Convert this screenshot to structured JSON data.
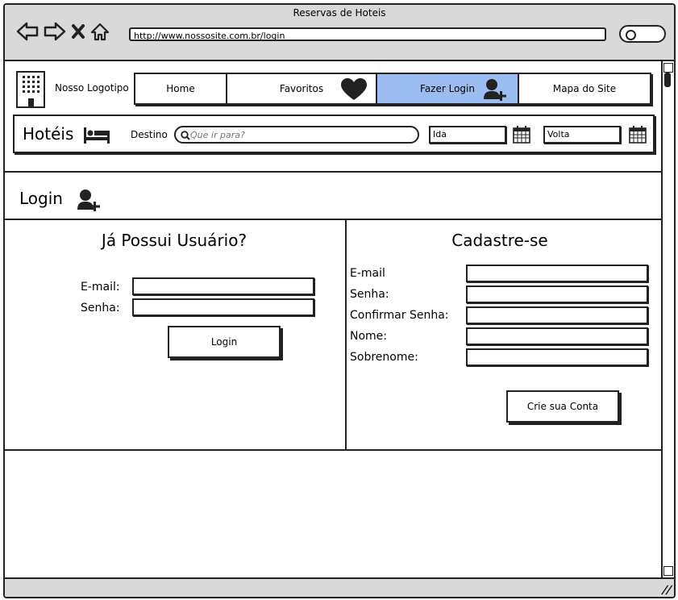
{
  "window": {
    "title": "Reservas de Hoteis"
  },
  "browser": {
    "url": "http://www.nossosite.com.br/login"
  },
  "header": {
    "logo_text": "Nosso Logotipo",
    "menu": [
      {
        "label": "Home"
      },
      {
        "label": "Favoritos",
        "icon": "heart-icon"
      },
      {
        "label": "Fazer Login",
        "icon": "user-add-icon",
        "active": true
      },
      {
        "label": "Mapa do Site"
      }
    ]
  },
  "search": {
    "brand": "Hotéis",
    "destino_label": "Destino",
    "destino_placeholder": "Que ir para?",
    "ida_value": "Ida",
    "volta_value": "Volta"
  },
  "page": {
    "title": "Login"
  },
  "login": {
    "heading": "Já Possui Usuário?",
    "email_label": "E-mail:",
    "senha_label": "Senha:",
    "button": "Login"
  },
  "register": {
    "heading": "Cadastre-se",
    "fields": [
      "E-mail",
      "Senha:",
      "Confirmar Senha:",
      "Nome:",
      "Sobrenome:"
    ],
    "button": "Crie sua Conta"
  },
  "colors": {
    "active_menu": "#9bbcf0",
    "chrome": "#d9d9d9"
  }
}
